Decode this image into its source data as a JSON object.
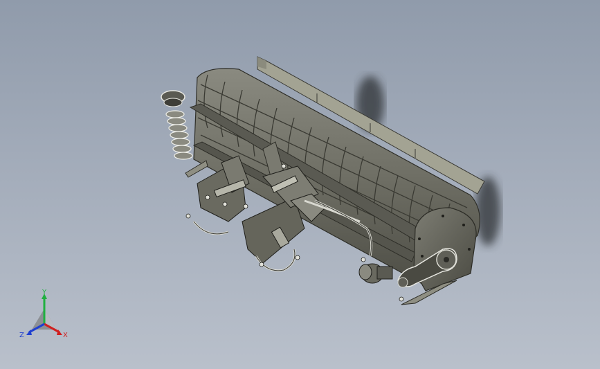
{
  "viewport": {
    "background_top": "#909bab",
    "background_bottom": "#b9c0cb",
    "model_color": "#6c6c62"
  },
  "triad": {
    "x_label": "X",
    "y_label": "Y",
    "z_label": "Z",
    "x_color": "#d02020",
    "y_color": "#20b040",
    "z_color": "#2040d0"
  }
}
